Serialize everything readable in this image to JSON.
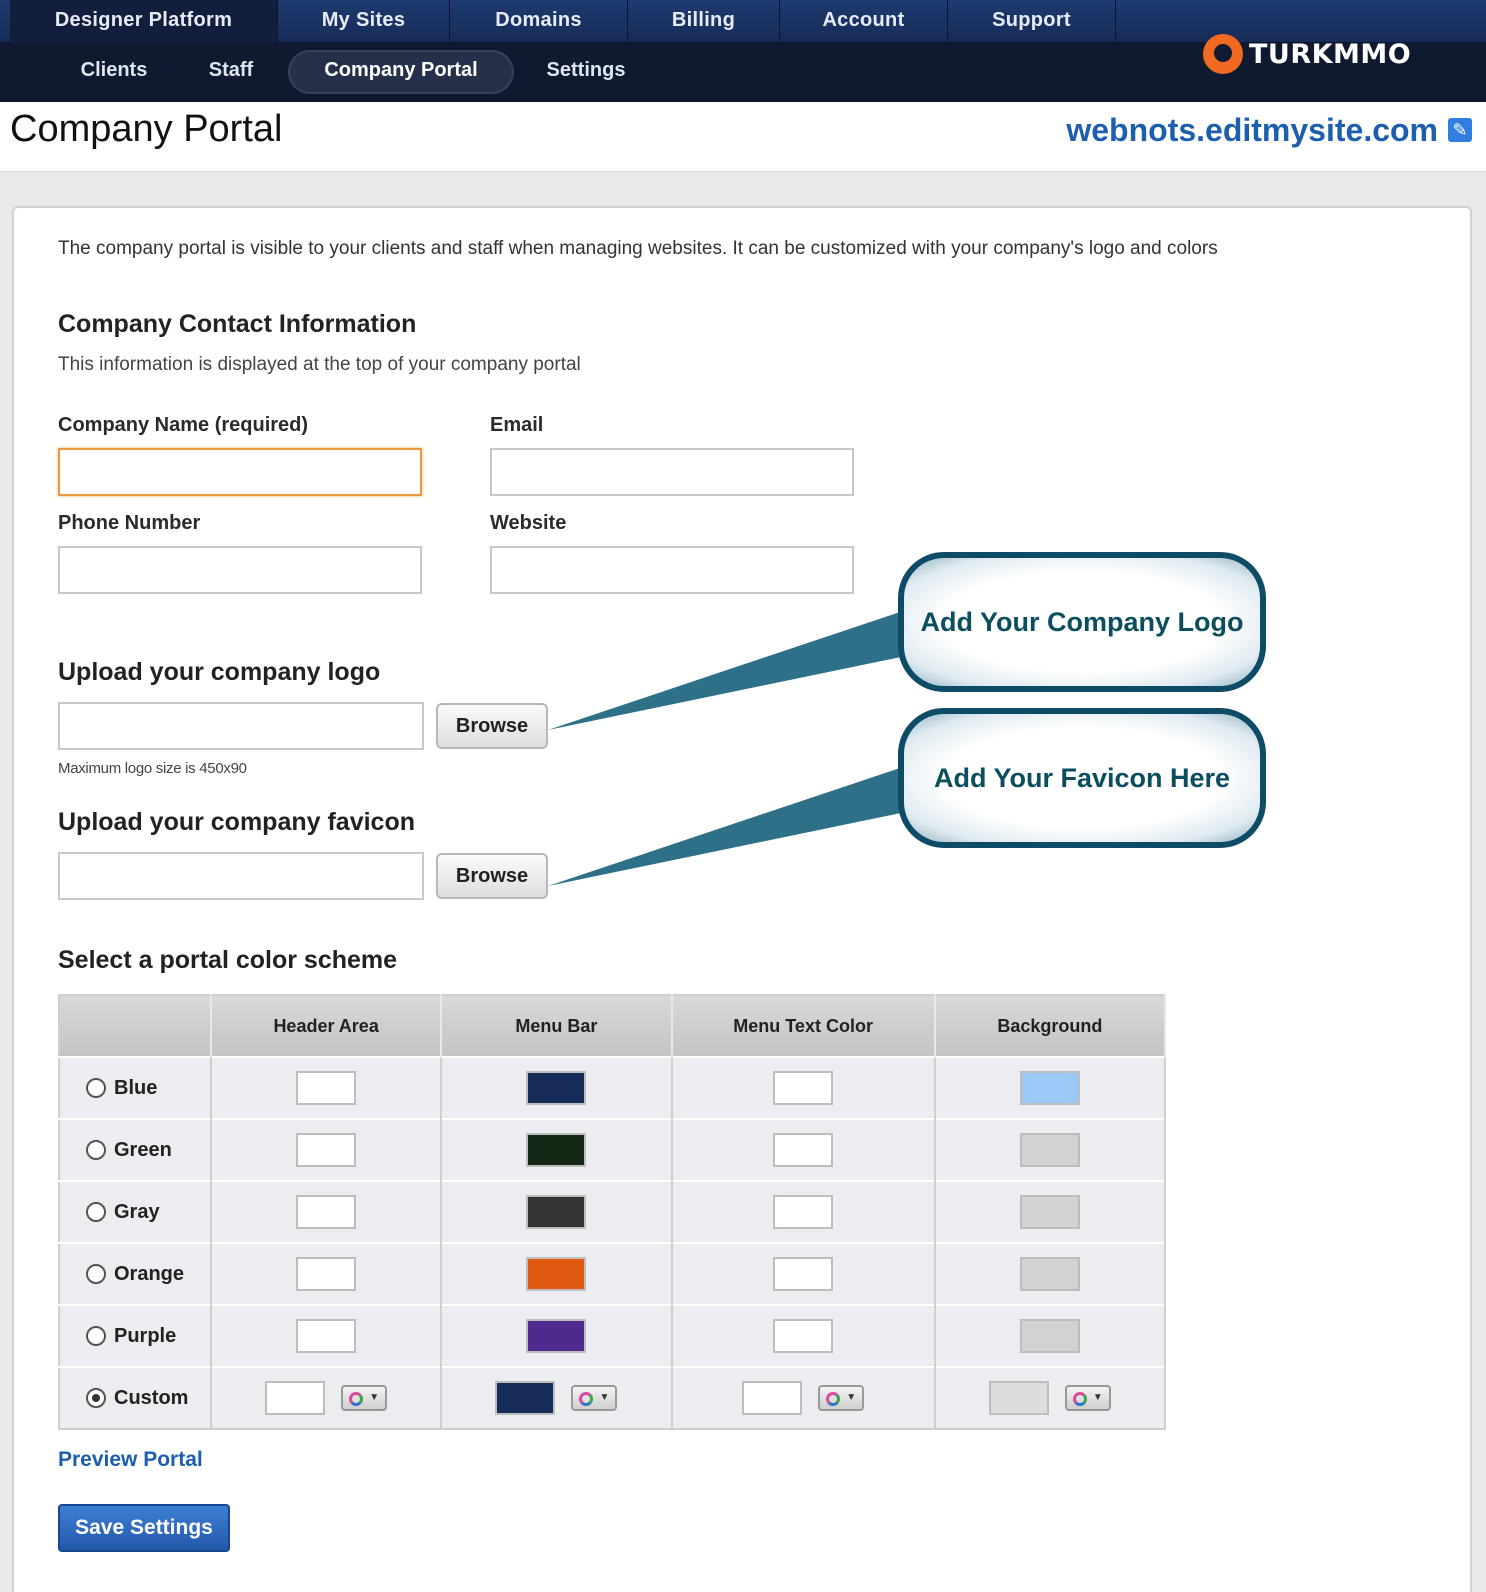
{
  "nav": {
    "top": [
      "Designer Platform",
      "My Sites",
      "Domains",
      "Billing",
      "Account",
      "Support"
    ],
    "sub": [
      "Clients",
      "Staff",
      "Company Portal",
      "Settings"
    ],
    "active_top": "Designer Platform",
    "active_sub": "Company Portal",
    "brand": "TURKMMO"
  },
  "header": {
    "title": "Company Portal",
    "site": "webnots.editmysite.com"
  },
  "intro": "The company portal is visible to your clients and staff when managing websites. It can be customized with your company's logo and colors",
  "contact": {
    "heading": "Company Contact Information",
    "description": "This information is displayed at the top of your company portal",
    "company_name_label": "Company Name (required)",
    "email_label": "Email",
    "phone_label": "Phone Number",
    "website_label": "Website",
    "company_name_value": "",
    "email_value": "",
    "phone_value": "",
    "website_value": ""
  },
  "logo": {
    "heading": "Upload your company logo",
    "browse_label": "Browse",
    "hint": "Maximum logo size is 450x90",
    "callout": "Add Your Company Logo"
  },
  "favicon": {
    "heading": "Upload your company favicon",
    "browse_label": "Browse",
    "callout": "Add Your Favicon Here"
  },
  "colors": {
    "heading": "Select a portal color scheme",
    "columns": [
      "",
      "Header Area",
      "Menu Bar",
      "Menu Text Color",
      "Background"
    ],
    "selected": "Custom",
    "rows": [
      {
        "name": "Blue",
        "header": "#ffffff",
        "menu": "#162c58",
        "text": "#ffffff",
        "background": "#9cc8f5"
      },
      {
        "name": "Green",
        "header": "#ffffff",
        "menu": "#132815",
        "text": "#ffffff",
        "background": "#d2d2d2"
      },
      {
        "name": "Gray",
        "header": "#ffffff",
        "menu": "#333333",
        "text": "#ffffff",
        "background": "#d2d2d2"
      },
      {
        "name": "Orange",
        "header": "#ffffff",
        "menu": "#e05a12",
        "text": "#ffffff",
        "background": "#d2d2d2"
      },
      {
        "name": "Purple",
        "header": "#ffffff",
        "menu": "#4e2a8c",
        "text": "#ffffff",
        "background": "#d2d2d2"
      },
      {
        "name": "Custom",
        "header": "#ffffff",
        "menu": "#162c58",
        "text": "#ffffff",
        "background": "#dddddd"
      }
    ]
  },
  "actions": {
    "preview": "Preview Portal",
    "save": "Save Settings"
  }
}
